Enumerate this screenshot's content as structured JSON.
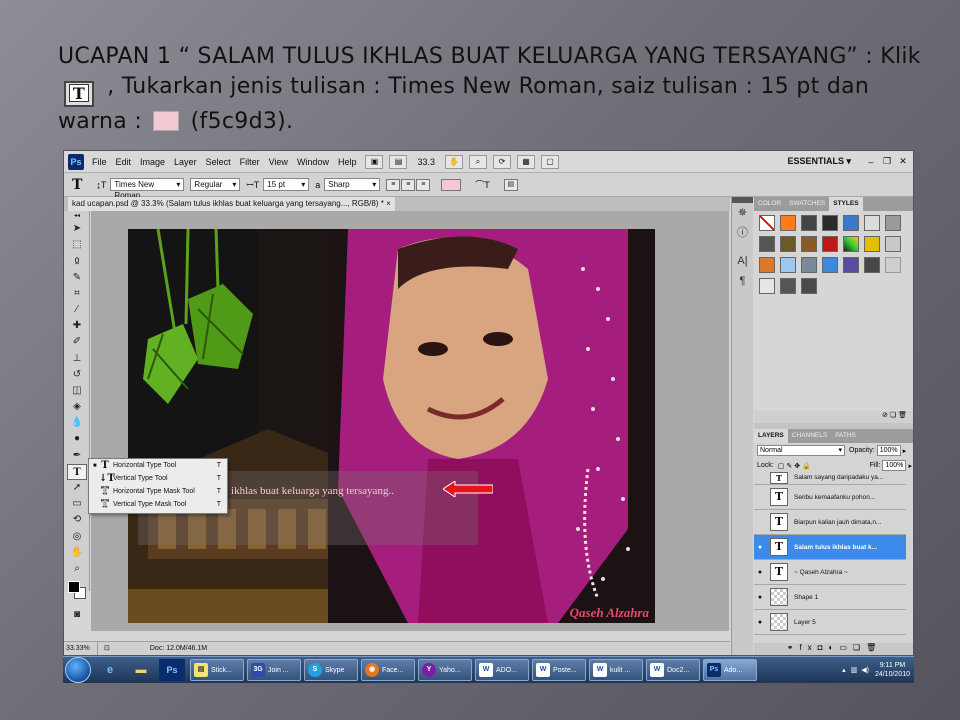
{
  "slide": {
    "title_part1": "UCAPAN 1 “ SALAM TULUS IKHLAS BUAT KELUARGA YANG TERSAYANG” : Klik",
    "title_part2": ", Tukarkan jenis tulisan : Times New Roman, saiz tulisan : 15 pt dan warna :",
    "title_part3": "(f5c9d3).",
    "type_icon_glyph": "T",
    "swatch_color": "#f5c9d3"
  },
  "menubar": {
    "logo": "Ps",
    "items": [
      "File",
      "Edit",
      "Image",
      "Layer",
      "Select",
      "Filter",
      "View",
      "Window",
      "Help"
    ],
    "zoom": "33.3",
    "workspace": "ESSENTIALS ▾"
  },
  "options": {
    "tool_glyph": "T",
    "font_family": "Times New Roman",
    "font_style": "Regular",
    "font_size": "15 pt",
    "aa_label": "a",
    "antialias": "Sharp",
    "text_color": "#f5c9d3"
  },
  "document": {
    "tab_title": "kad ucapan.psd @ 33.3% (Salam tulus ikhlas buat keluarga yang tersayang..., RGB/8) *  ×",
    "art_text": "s ikhlas buat keluarga yang tersayang..",
    "signature": "Qaseh Alzahra",
    "status_zoom": "33.33%",
    "status_doc": "Doc: 12.0M/46.1M"
  },
  "type_flyout": [
    {
      "label": "Horizontal Type Tool",
      "shortcut": "T",
      "selected": true
    },
    {
      "label": "Vertical Type Tool",
      "shortcut": "T",
      "selected": false
    },
    {
      "label": "Horizontal Type Mask Tool",
      "shortcut": "T",
      "selected": false
    },
    {
      "label": "Vertical Type Mask Tool",
      "shortcut": "T",
      "selected": false
    }
  ],
  "panels": {
    "top_tabs": [
      "COLOR",
      "SWATCHES",
      "STYLES"
    ],
    "active_top_tab": "STYLES",
    "layer_tabs": [
      "LAYERS",
      "CHANNELS",
      "PATHS"
    ],
    "active_layer_tab": "LAYERS",
    "blend_mode": "Normal",
    "opacity_label": "Opacity:",
    "opacity": "100%",
    "lock_label": "Lock:",
    "fill_label": "Fill:",
    "fill": "100%",
    "layers": [
      {
        "name": "Salam sayang daripadaku ya...",
        "type": "text"
      },
      {
        "name": "Seribu kemaafanku pohon...",
        "type": "text"
      },
      {
        "name": "Biarpun kalian jauh dimata,n...",
        "type": "text"
      },
      {
        "name": "Salam tulus ikhlas buat k...",
        "type": "text",
        "selected": true
      },
      {
        "name": "~ Qaseh Alzahra ~",
        "type": "text"
      },
      {
        "name": "Shape 1",
        "type": "shape"
      },
      {
        "name": "Layer 5",
        "type": "image"
      }
    ]
  },
  "taskbar": {
    "tasks": [
      "Stick...",
      "Join ...",
      "Skype",
      "Face...",
      "Yaho...",
      "ADO...",
      "Poste...",
      "kulit ...",
      "Doc2...",
      "Ado..."
    ],
    "time": "9:11 PM",
    "date": "24/10/2010"
  }
}
